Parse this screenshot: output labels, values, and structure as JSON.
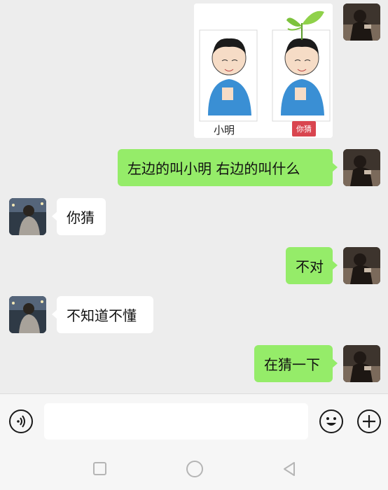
{
  "messages": {
    "image": {
      "caption_left": "小明",
      "caption_right": "你猜"
    },
    "m1": "左边的叫小明  右边的叫什么",
    "m2": "你猜",
    "m3": "不对",
    "m4": "不知道不懂",
    "m5": "在猜一下"
  },
  "input": {
    "value": "",
    "placeholder": ""
  },
  "icons": {
    "voice": "voice-icon",
    "emoji": "emoji-icon",
    "plus": "plus-icon",
    "nav_square": "recent-apps-icon",
    "nav_circle": "home-icon",
    "nav_back": "back-icon"
  },
  "colors": {
    "my_bubble": "#95ec69",
    "other_bubble": "#ffffff",
    "background": "#ededed"
  }
}
